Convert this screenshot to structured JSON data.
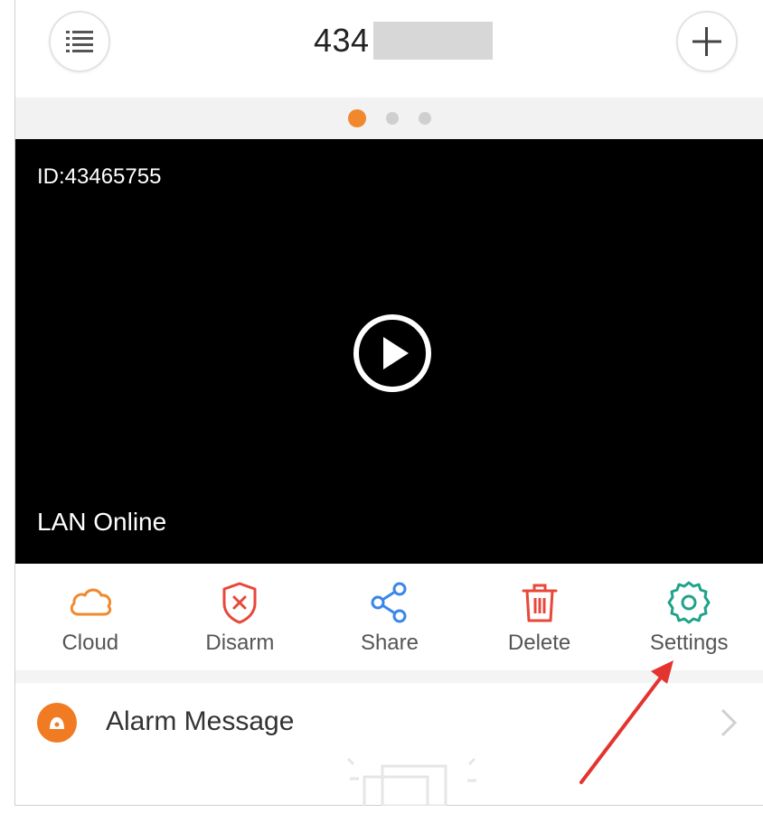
{
  "header": {
    "title": "434",
    "menu_icon": "list-icon",
    "add_icon": "plus-icon"
  },
  "pager": {
    "count": 3,
    "active_index": 0
  },
  "video": {
    "device_id": "ID:43465755",
    "status": "LAN Online",
    "play_icon": "play-icon"
  },
  "actions": [
    {
      "label": "Cloud",
      "icon": "cloud-icon",
      "color": "#f0892e"
    },
    {
      "label": "Disarm",
      "icon": "shield-x-icon",
      "color": "#e8473a"
    },
    {
      "label": "Share",
      "icon": "share-icon",
      "color": "#3a86e8"
    },
    {
      "label": "Delete",
      "icon": "trash-icon",
      "color": "#e8473a"
    },
    {
      "label": "Settings",
      "icon": "gear-icon",
      "color": "#1fa38a"
    }
  ],
  "alarm": {
    "label": "Alarm Message",
    "icon": "alarm-icon",
    "icon_color": "#f07b22"
  },
  "colors": {
    "accent": "#f0892e",
    "annotation_arrow": "#e3342f"
  }
}
